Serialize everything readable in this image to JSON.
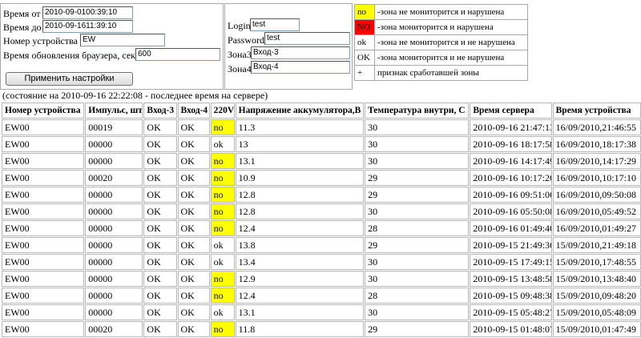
{
  "form": {
    "time_from_label": "Время от",
    "time_from_value": "2010-09-0100:39:10",
    "time_to_label": "Время до",
    "time_to_value": "2010-09-1611:39:10",
    "device_label": "Номер устройства",
    "device_value": "EW",
    "refresh_label": "Время обновления браузера, сек",
    "refresh_value": "600",
    "apply_button": "Применить настройки",
    "login_label": "Login",
    "login_value": "test",
    "password_label": "Password",
    "password_value": "test",
    "zone3_label": "Зона3",
    "zone3_value": "Вход-3",
    "zone4_label": "Зона4",
    "zone4_value": "Вход-4"
  },
  "legend": [
    {
      "key": "no",
      "text": "-зона не мониторится и нарушена",
      "color": "#ffff00"
    },
    {
      "key": "NO",
      "text": "-зона мониторится и нарушена",
      "color": "#ff0000"
    },
    {
      "key": "ok",
      "text": "-зона не мониторится и не нарушена",
      "color": ""
    },
    {
      "key": "OK",
      "text": "-зона мониторится и не нарушена",
      "color": ""
    },
    {
      "key": "+",
      "text": "признак сработавшей зоны",
      "color": ""
    }
  ],
  "status_text": "(состояние на 2010-09-16 22:22:08 - последнее время на сервере)",
  "table": {
    "headers": [
      "Номер устройства",
      "Импульс, шт",
      "Вход-3",
      "Вход-4",
      "220V",
      "Напряжение аккумулятора,В",
      "Температура внутри, С",
      "Время сервера",
      "Время устройства"
    ],
    "rows": [
      [
        "EW00",
        "00019",
        "OK",
        "OK",
        "no",
        "11.3",
        "30",
        "2010-09-16 21:47:13",
        "16/09/2010,21:46:55"
      ],
      [
        "EW00",
        "00000",
        "OK",
        "OK",
        "ok",
        "13",
        "30",
        "2010-09-16 18:17:58",
        "16/09/2010,18:17:38"
      ],
      [
        "EW00",
        "00000",
        "OK",
        "OK",
        "no",
        "13.1",
        "30",
        "2010-09-16 14:17:49",
        "16/09/2010,14:17:29"
      ],
      [
        "EW00",
        "00020",
        "OK",
        "OK",
        "no",
        "10.9",
        "29",
        "2010-09-16 10:17:26",
        "16/09/2010,10:17:10"
      ],
      [
        "EW00",
        "00000",
        "OK",
        "OK",
        "no",
        "12.8",
        "29",
        "2010-09-16 09:51:06",
        "16/09/2010,09:50:08"
      ],
      [
        "EW00",
        "00000",
        "OK",
        "OK",
        "no",
        "12.8",
        "30",
        "2010-09-16 05:50:08",
        "16/09/2010,05:49:52"
      ],
      [
        "EW00",
        "00000",
        "OK",
        "OK",
        "no",
        "12.4",
        "28",
        "2010-09-16 01:49:46",
        "16/09/2010,01:49:27"
      ],
      [
        "EW00",
        "00000",
        "OK",
        "OK",
        "ok",
        "13.8",
        "29",
        "2010-09-15 21:49:36",
        "15/09/2010,21:49:18"
      ],
      [
        "EW00",
        "00000",
        "OK",
        "OK",
        "ok",
        "13.4",
        "30",
        "2010-09-15 17:49:15",
        "15/09/2010,17:48:55"
      ],
      [
        "EW00",
        "00000",
        "OK",
        "OK",
        "no",
        "12.9",
        "30",
        "2010-09-15 13:48:58",
        "15/09/2010,13:48:40"
      ],
      [
        "EW00",
        "00000",
        "OK",
        "OK",
        "no",
        "12.4",
        "28",
        "2010-09-15 09:48:38",
        "15/09/2010,09:48:20"
      ],
      [
        "EW00",
        "00000",
        "OK",
        "OK",
        "ok",
        "13.1",
        "30",
        "2010-09-15 05:48:27",
        "15/09/2010,05:48:09"
      ],
      [
        "EW00",
        "00020",
        "OK",
        "OK",
        "no",
        "11.8",
        "29",
        "2010-09-15 01:48:07",
        "15/09/2010,01:47:49"
      ]
    ]
  }
}
